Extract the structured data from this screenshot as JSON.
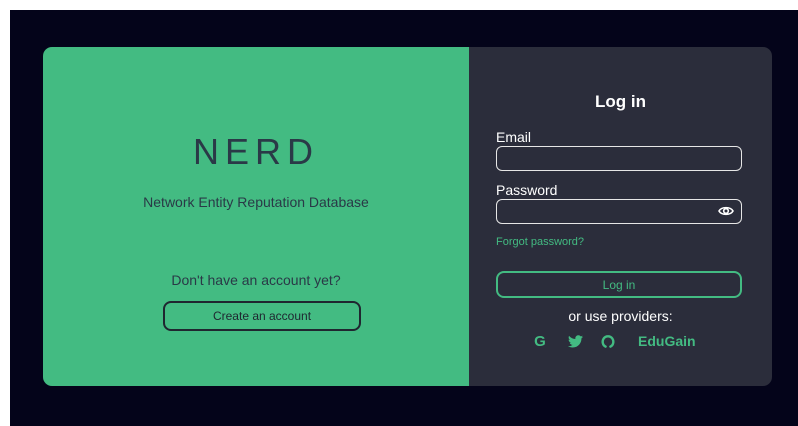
{
  "brand": {
    "name": "NERD",
    "subtitle": "Network Entity Reputation Database"
  },
  "signup": {
    "prompt": "Don't have an account yet?",
    "button_label": "Create an account"
  },
  "login": {
    "title": "Log in",
    "email_label": "Email",
    "email_value": "",
    "password_label": "Password",
    "password_value": "",
    "forgot_label": "Forgot password?",
    "submit_label": "Log in",
    "providers_label": "or use providers:",
    "providers": [
      {
        "name": "google",
        "label": "G",
        "icon": "google-icon"
      },
      {
        "name": "twitter",
        "label": "",
        "icon": "twitter-icon"
      },
      {
        "name": "github",
        "label": "",
        "icon": "github-icon"
      },
      {
        "name": "edugain",
        "label": "EduGain",
        "icon": ""
      }
    ]
  },
  "colors": {
    "accent": "#43bb82",
    "panel_dark": "#2b2d3b",
    "background": "#04041a",
    "text_dark": "#2a3947"
  }
}
